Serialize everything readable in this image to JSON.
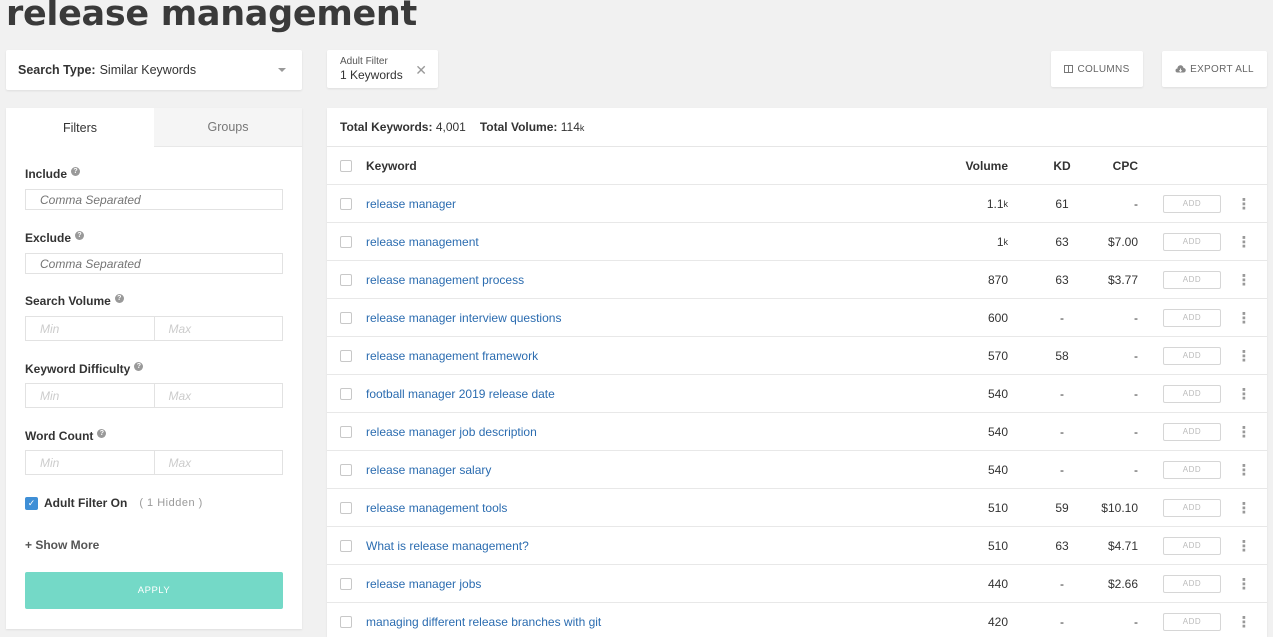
{
  "title": "release management",
  "search_type": {
    "label": "Search Type:",
    "value": "Similar Keywords"
  },
  "adult_filter_chip": {
    "title": "Adult Filter",
    "value": "1 Keywords"
  },
  "buttons": {
    "columns": "COLUMNS",
    "export": "EXPORT ALL"
  },
  "sidebar": {
    "tabs": [
      "Filters",
      "Groups"
    ],
    "include": {
      "label": "Include",
      "placeholder": "Comma Separated"
    },
    "exclude": {
      "label": "Exclude",
      "placeholder": "Comma Separated"
    },
    "search_volume": {
      "label": "Search Volume",
      "min": "Min",
      "max": "Max"
    },
    "keyword_difficulty": {
      "label": "Keyword Difficulty",
      "min": "Min",
      "max": "Max"
    },
    "word_count": {
      "label": "Word Count",
      "min": "Min",
      "max": "Max"
    },
    "adult_filter": {
      "label": "Adult Filter On",
      "hidden": "( 1 Hidden )",
      "checked": true
    },
    "show_more": "+ Show More",
    "apply": "APPLY"
  },
  "summary": {
    "keywords_label": "Total Keywords:",
    "keywords_value": "4,001",
    "volume_label": "Total Volume:",
    "volume_value": "114",
    "volume_suffix": "k"
  },
  "table": {
    "headers": {
      "keyword": "Keyword",
      "volume": "Volume",
      "kd": "KD",
      "cpc": "CPC"
    },
    "add_label": "ADD",
    "rows": [
      {
        "keyword": "release manager",
        "volume": "1.1",
        "volume_suffix": "k",
        "kd": "61",
        "cpc": "-"
      },
      {
        "keyword": "release management",
        "volume": "1",
        "volume_suffix": "k",
        "kd": "63",
        "cpc": "$7.00"
      },
      {
        "keyword": "release management process",
        "volume": "870",
        "volume_suffix": "",
        "kd": "63",
        "cpc": "$3.77"
      },
      {
        "keyword": "release manager interview questions",
        "volume": "600",
        "volume_suffix": "",
        "kd": "-",
        "cpc": "-"
      },
      {
        "keyword": "release management framework",
        "volume": "570",
        "volume_suffix": "",
        "kd": "58",
        "cpc": "-"
      },
      {
        "keyword": "football manager 2019 release date",
        "volume": "540",
        "volume_suffix": "",
        "kd": "-",
        "cpc": "-"
      },
      {
        "keyword": "release manager job description",
        "volume": "540",
        "volume_suffix": "",
        "kd": "-",
        "cpc": "-"
      },
      {
        "keyword": "release manager salary",
        "volume": "540",
        "volume_suffix": "",
        "kd": "-",
        "cpc": "-"
      },
      {
        "keyword": "release management tools",
        "volume": "510",
        "volume_suffix": "",
        "kd": "59",
        "cpc": "$10.10"
      },
      {
        "keyword": "What is release management?",
        "volume": "510",
        "volume_suffix": "",
        "kd": "63",
        "cpc": "$4.71"
      },
      {
        "keyword": "release manager jobs",
        "volume": "440",
        "volume_suffix": "",
        "kd": "-",
        "cpc": "$2.66"
      },
      {
        "keyword": "managing different release branches with git",
        "volume": "420",
        "volume_suffix": "",
        "kd": "-",
        "cpc": "-"
      }
    ]
  },
  "colors": {
    "link": "#2b6cb0",
    "apply": "#74d9c7",
    "checkbox": "#3f8fd6"
  }
}
